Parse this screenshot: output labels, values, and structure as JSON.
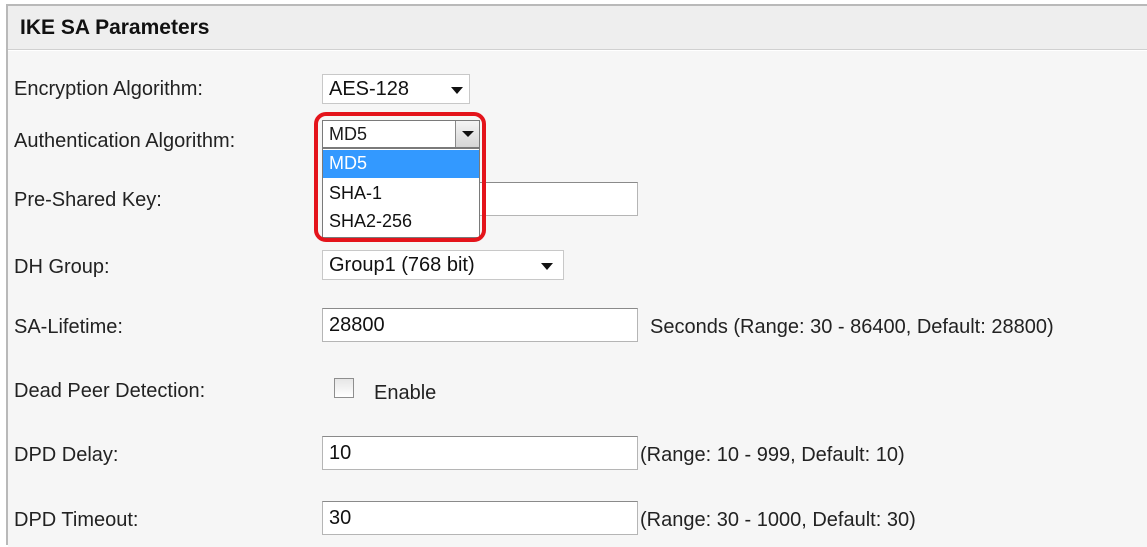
{
  "section": {
    "title": "IKE SA Parameters"
  },
  "fields": {
    "encryption": {
      "label": "Encryption Algorithm:",
      "value": "AES-128"
    },
    "authentication": {
      "label": "Authentication Algorithm:",
      "value": "MD5",
      "options": [
        "MD5",
        "SHA-1",
        "SHA2-256"
      ],
      "selected_index": 0,
      "expanded": true
    },
    "psk": {
      "label": "Pre-Shared Key:",
      "value": ""
    },
    "dh_group": {
      "label": "DH Group:",
      "value": "Group1 (768 bit)"
    },
    "sa_lifetime": {
      "label": "SA-Lifetime:",
      "value": "28800",
      "hint": "Seconds  (Range: 30 - 86400, Default: 28800)"
    },
    "dpd": {
      "label": "Dead Peer Detection:",
      "checkbox_label": "Enable",
      "checked": false
    },
    "dpd_delay": {
      "label": "DPD Delay:",
      "value": "10",
      "hint": "(Range: 10 - 999, Default: 10)"
    },
    "dpd_timeout": {
      "label": "DPD Timeout:",
      "value": "30",
      "hint": "(Range: 30 - 1000, Default: 30)"
    }
  },
  "colors": {
    "highlight": "#e4141b",
    "selection": "#3399ff",
    "header_bg": "#eeeeee"
  }
}
